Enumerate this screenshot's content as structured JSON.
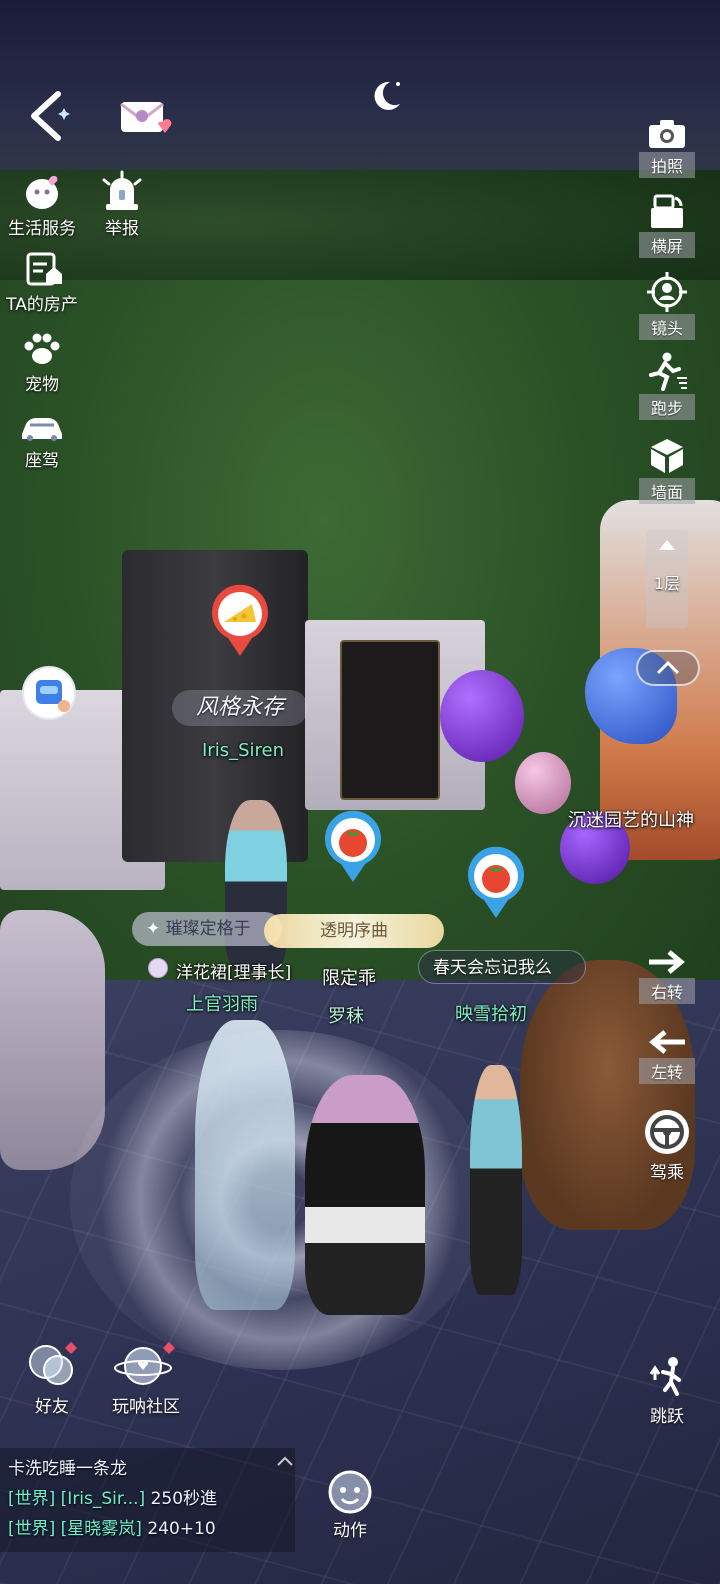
{
  "top_bar": {
    "back_icon": "chevron-left-icon",
    "mail_icon": "envelope-heart-icon",
    "time_icon": "moon-stars-icon"
  },
  "left_menu": [
    {
      "label": "生活服务",
      "icon": "ghost-balloon-icon"
    },
    {
      "label": "举报",
      "icon": "siren-icon"
    },
    {
      "label": "TA的房产",
      "icon": "house-card-icon"
    },
    {
      "label": "宠物",
      "icon": "paw-icon"
    },
    {
      "label": "座驾",
      "icon": "car-icon"
    }
  ],
  "right_menu": [
    {
      "label": "拍照",
      "icon": "camera-icon"
    },
    {
      "label": "横屏",
      "icon": "rotate-screen-icon"
    },
    {
      "label": "镜头",
      "icon": "lens-target-icon"
    },
    {
      "label": "跑步",
      "icon": "running-icon"
    },
    {
      "label": "墙面",
      "icon": "cube-wall-icon"
    }
  ],
  "floor_selector": {
    "label": "1层"
  },
  "right_actions": [
    {
      "label": "右转",
      "icon": "arrow-right-icon"
    },
    {
      "label": "左转",
      "icon": "arrow-left-icon"
    },
    {
      "label": "驾乘",
      "icon": "steering-wheel-icon"
    }
  ],
  "jump": {
    "label": "跳跃",
    "icon": "jump-icon"
  },
  "bottom_left": [
    {
      "label": "好友",
      "icon": "friends-bubble-icon"
    },
    {
      "label": "玩呐社区",
      "icon": "community-planet-icon"
    }
  ],
  "action_button": {
    "label": "动作",
    "icon": "emote-face-icon"
  },
  "scene_labels": {
    "shop_sign": "风格永存",
    "owner_name": "Iris_Siren",
    "player_top_right": "沉迷园艺的山神",
    "player_title": "璀璨定格于",
    "banner": "透明序曲",
    "guild_tag": "洋花裙[理事长]",
    "player_mid": "限定乖",
    "spring_bubble": "春天会忘记我么",
    "player_left": "上官羽雨",
    "player_center": "罗秣",
    "player_right": "映雪拾初"
  },
  "chat": {
    "lines": [
      {
        "channel": "",
        "sender": "",
        "text": "卡洗吃睡一条龙"
      },
      {
        "channel": "[世界]",
        "sender": "[Iris_Sir...]",
        "text": "250秒進"
      },
      {
        "channel": "[世界]",
        "sender": "[星晓雾岚]",
        "text": "240+10"
      }
    ]
  },
  "colors": {
    "accent_green": "#7ef0c2",
    "pin_red": "#e84a3e",
    "pin_blue": "#3aa3e8"
  }
}
